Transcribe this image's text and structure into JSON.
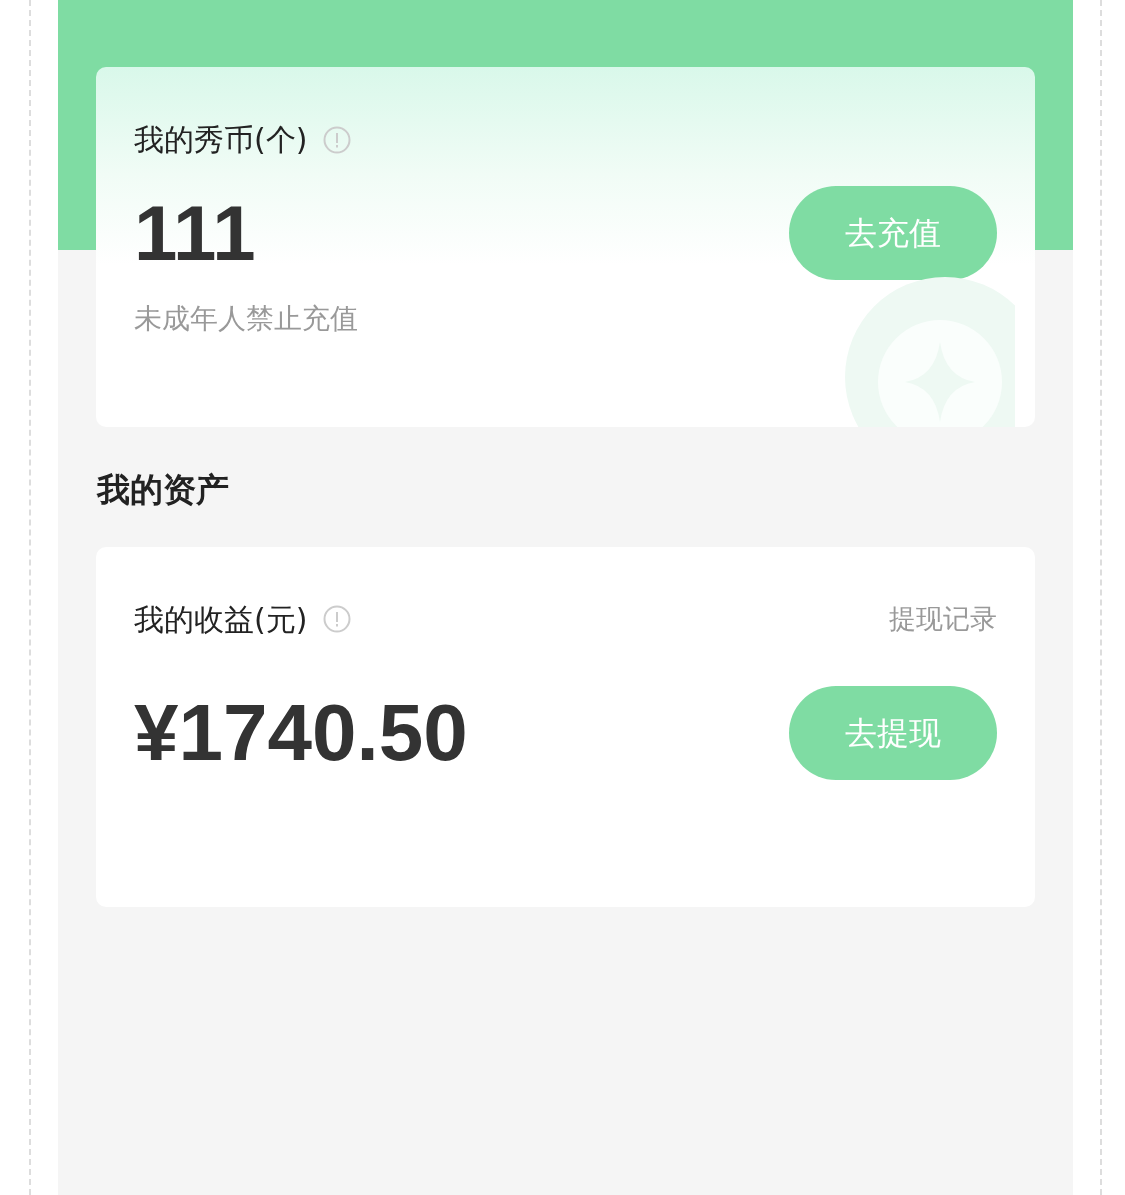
{
  "coin_card": {
    "title": "我的秀币(个)",
    "amount": "111",
    "notice": "未成年人禁止充值",
    "button": "去充值"
  },
  "section_title": "我的资产",
  "earnings_card": {
    "title": "我的收益(元)",
    "link": "提现记录",
    "amount": "¥1740.50",
    "button": "去提现"
  }
}
